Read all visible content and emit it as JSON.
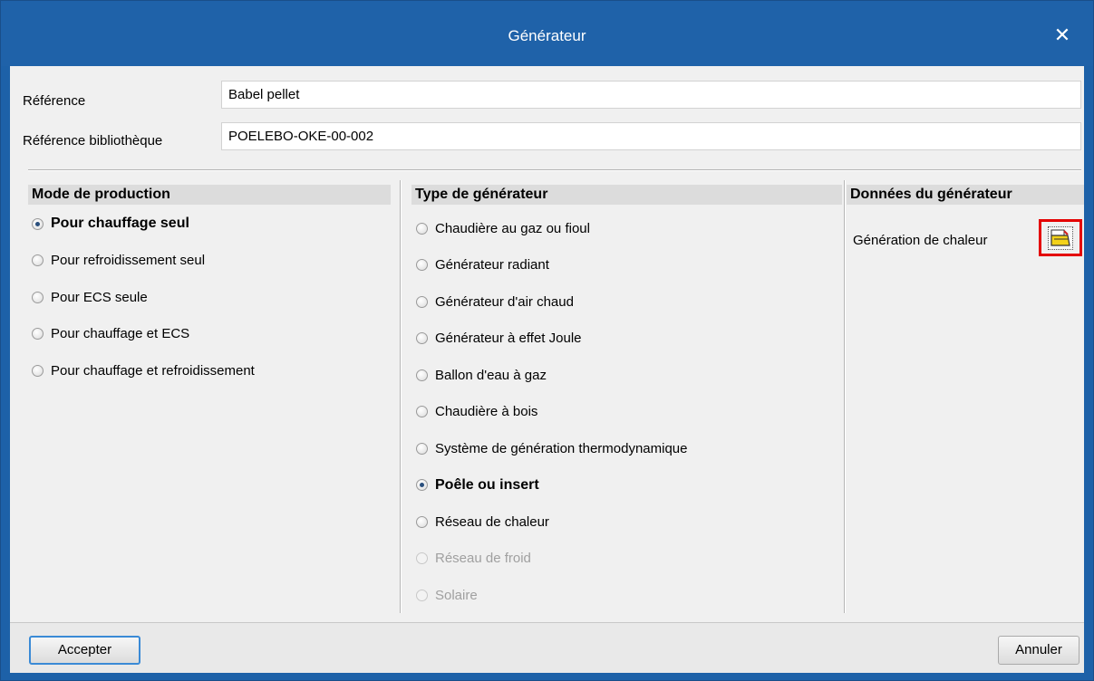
{
  "window": {
    "title": "Générateur"
  },
  "form": {
    "reference_label": "Référence",
    "reference_value": "Babel pellet",
    "library_reference_label": "Référence bibliothèque",
    "library_reference_value": "POELEBO-OKE-00-002"
  },
  "production_mode": {
    "heading": "Mode de production",
    "options": [
      {
        "label": "Pour chauffage seul",
        "checked": true
      },
      {
        "label": "Pour refroidissement seul",
        "checked": false
      },
      {
        "label": "Pour ECS seule",
        "checked": false
      },
      {
        "label": "Pour chauffage et ECS",
        "checked": false
      },
      {
        "label": "Pour chauffage et refroidissement",
        "checked": false
      }
    ]
  },
  "generator_type": {
    "heading": "Type de générateur",
    "options": [
      {
        "label": "Chaudière au gaz ou fioul",
        "checked": false,
        "enabled": true
      },
      {
        "label": "Générateur radiant",
        "checked": false,
        "enabled": true
      },
      {
        "label": "Générateur d'air chaud",
        "checked": false,
        "enabled": true
      },
      {
        "label": "Générateur à effet Joule",
        "checked": false,
        "enabled": true
      },
      {
        "label": "Ballon d'eau à gaz",
        "checked": false,
        "enabled": true
      },
      {
        "label": "Chaudière à bois",
        "checked": false,
        "enabled": true
      },
      {
        "label": "Système de génération thermodynamique",
        "checked": false,
        "enabled": true
      },
      {
        "label": "Poêle ou insert",
        "checked": true,
        "enabled": true
      },
      {
        "label": "Réseau de chaleur",
        "checked": false,
        "enabled": true
      },
      {
        "label": "Réseau de froid",
        "checked": false,
        "enabled": false
      },
      {
        "label": "Solaire",
        "checked": false,
        "enabled": false
      }
    ]
  },
  "generator_data": {
    "heading": "Données du générateur",
    "heat_generation_label": "Génération de chaleur",
    "edit_icon": "edit-folder-icon",
    "highlight_color": "#e40000"
  },
  "footer": {
    "accept_label": "Accepter",
    "cancel_label": "Annuler"
  },
  "colors": {
    "titlebar": "#1f62a9",
    "accent": "#3a8ad6",
    "dialog_bg": "#f0f0f0"
  }
}
